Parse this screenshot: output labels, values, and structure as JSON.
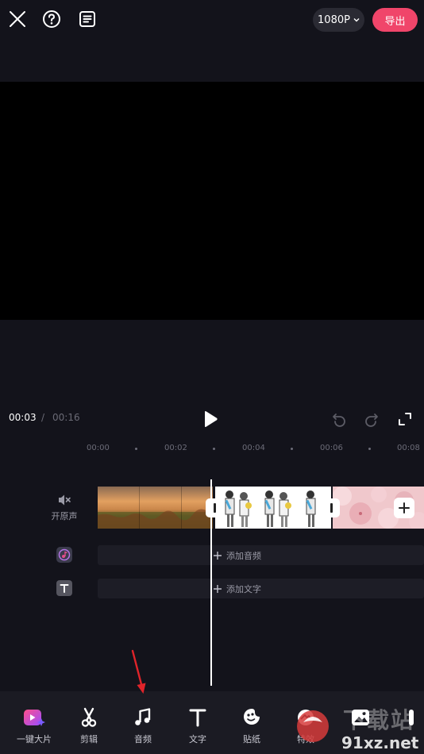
{
  "header": {
    "resolution_label": "1080P",
    "export_label": "导出"
  },
  "playback": {
    "current_time": "00:03",
    "separator": "/",
    "total_time": "00:16"
  },
  "ruler": {
    "ticks": [
      "00:00",
      "00:02",
      "00:04",
      "00:06",
      "00:08"
    ]
  },
  "tracks": {
    "original_sound_label": "开原声",
    "add_audio_label": "添加音频",
    "add_text_label": "添加文字"
  },
  "toolbar": {
    "items": [
      {
        "label": "一键大片",
        "icon": "magic-film-icon"
      },
      {
        "label": "剪辑",
        "icon": "scissors-icon"
      },
      {
        "label": "音频",
        "icon": "music-note-icon"
      },
      {
        "label": "文字",
        "icon": "text-t-icon"
      },
      {
        "label": "贴纸",
        "icon": "sticker-icon"
      },
      {
        "label": "特效",
        "icon": "effects-icon"
      }
    ]
  },
  "watermark": {
    "text_cn": "下载站",
    "text_en": "91xz.net"
  },
  "colors": {
    "accent": "#f0456a",
    "background": "#13131b",
    "toolbar": "#1b1b23",
    "annotation_arrow": "#e0242a"
  }
}
